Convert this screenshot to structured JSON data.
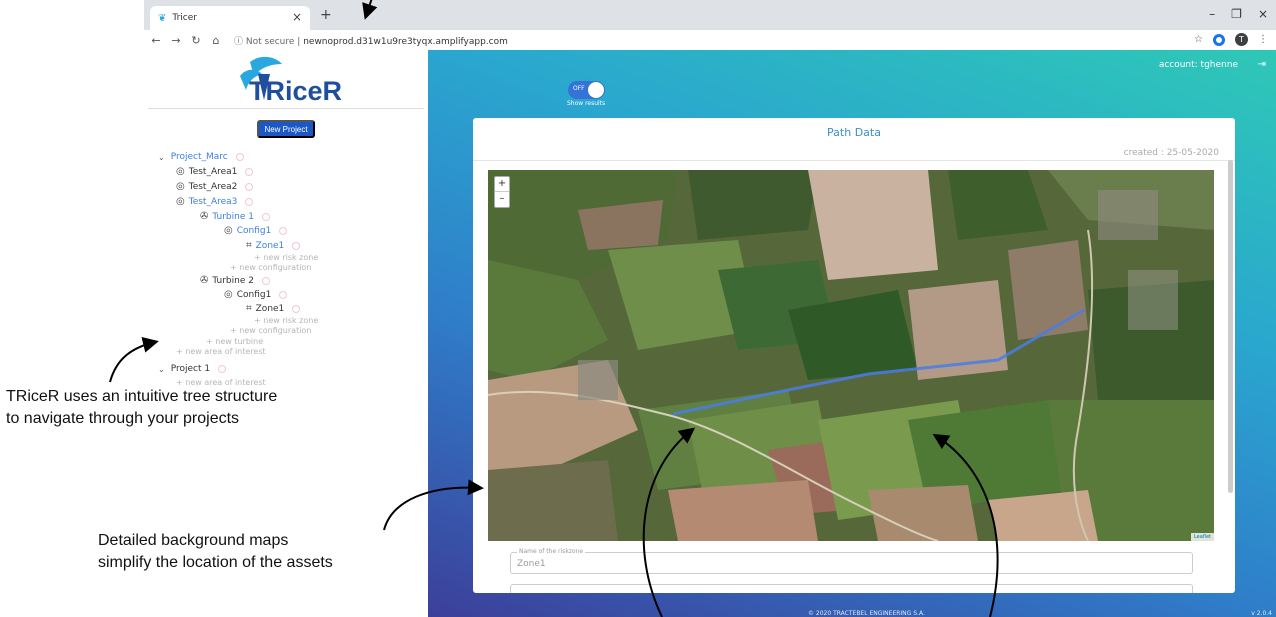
{
  "browser": {
    "tab_title": "Tricer",
    "tab_close": "×",
    "new_tab": "+",
    "security": "Not secure",
    "url": "newnoprod.d31w1u9re3tyqx.amplifyapp.com",
    "window_controls": [
      "–",
      "❐",
      "×"
    ],
    "profile_initial": "T"
  },
  "sidebar": {
    "logo_text": "TRiceR",
    "new_project": "New Project",
    "tree": {
      "project1": "Project_Marc",
      "area1": "Test_Area1",
      "area2": "Test_Area2",
      "area3": "Test_Area3",
      "turbine1": "Turbine 1",
      "t1_config": "Config1",
      "t1_zone": "Zone1",
      "t1_new_zone": "+ new risk zone",
      "t1_new_config": "+ new configuration",
      "turbine2": "Turbine 2",
      "t2_config": "Config1",
      "t2_zone": "Zone1",
      "t2_new_zone": "+ new risk zone",
      "t2_new_config": "+ new configuration",
      "new_turbine": "+ new turbine",
      "new_area": "+ new area of interest",
      "project2": "Project 1",
      "p2_new_area": "+ new area of interest"
    }
  },
  "main": {
    "toggle_label": "OFF",
    "show_results": "Show results",
    "account": "account: tghenne",
    "card_title": "Path Data",
    "created": "created : 25-05-2020",
    "zoom_in": "+",
    "zoom_out": "–",
    "attribution": "Leaflet",
    "riskzone_label": "Name of the riskzone",
    "riskzone_value": "Zone1",
    "footer": "© 2020 TRACTEBEL ENGINEERING S.A.",
    "version": "v 2.0.4"
  },
  "annotations": {
    "tree_note_line1": "TRiceR uses an intuitive tree structure",
    "tree_note_line2": "to navigate through your projects",
    "map_note_line1": "Detailed background maps",
    "map_note_line2": "simplify the location of the assets"
  },
  "colors": {
    "accent": "#1a57c7",
    "active_tree": "#3b7fe0",
    "path_line": "#4a7de8"
  }
}
